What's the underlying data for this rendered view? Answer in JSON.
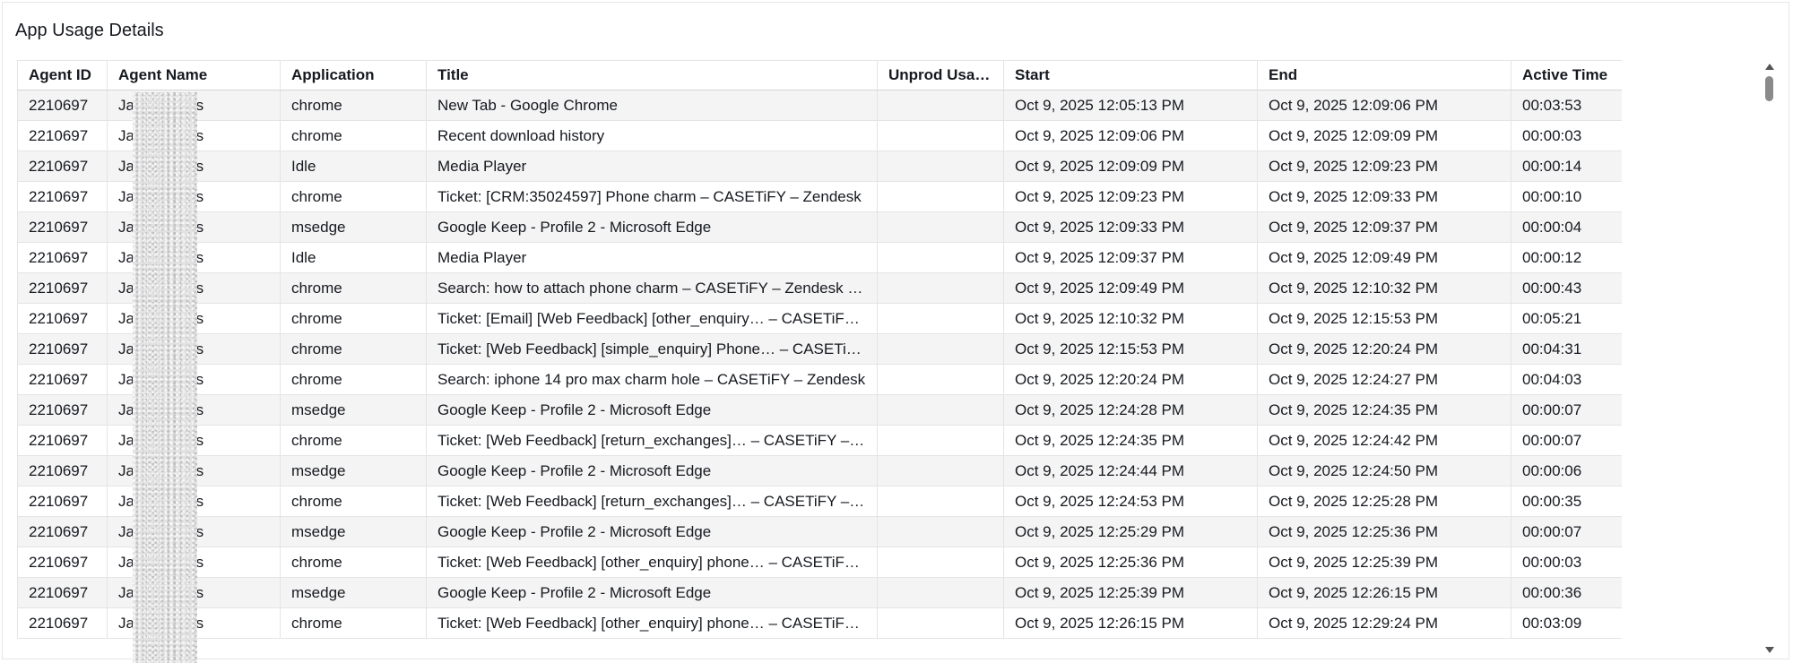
{
  "panel": {
    "title": "App Usage Details"
  },
  "table": {
    "columns": [
      "Agent ID",
      "Agent Name",
      "Application",
      "Title",
      "Unprod Usage",
      "Start",
      "End",
      "Active Time"
    ],
    "rows": [
      [
        "2210697",
        "Jay",
        "res",
        "chrome",
        "New Tab - Google Chrome",
        "",
        "Oct 9, 2025 12:05:13 PM",
        "Oct 9, 2025 12:09:06 PM",
        "00:03:53"
      ],
      [
        "2210697",
        "Jay",
        "res",
        "chrome",
        "Recent download history",
        "",
        "Oct 9, 2025 12:09:06 PM",
        "Oct 9, 2025 12:09:09 PM",
        "00:00:03"
      ],
      [
        "2210697",
        "Jay",
        "res",
        "Idle",
        "Media Player",
        "",
        "Oct 9, 2025 12:09:09 PM",
        "Oct 9, 2025 12:09:23 PM",
        "00:00:14"
      ],
      [
        "2210697",
        "Jay",
        "res",
        "chrome",
        "Ticket: [CRM:35024597] Phone charm – CASETiFY – Zendesk",
        "",
        "Oct 9, 2025 12:09:23 PM",
        "Oct 9, 2025 12:09:33 PM",
        "00:00:10"
      ],
      [
        "2210697",
        "Jay",
        "res",
        "msedge",
        "Google Keep - Profile 2 - Microsoft Edge",
        "",
        "Oct 9, 2025 12:09:33 PM",
        "Oct 9, 2025 12:09:37 PM",
        "00:00:04"
      ],
      [
        "2210697",
        "Jay",
        "res",
        "Idle",
        "Media Player",
        "",
        "Oct 9, 2025 12:09:37 PM",
        "Oct 9, 2025 12:09:49 PM",
        "00:00:12"
      ],
      [
        "2210697",
        "Jay",
        "res",
        "chrome",
        "Search: how to attach phone charm – CASETiFY – Zendesk - Google Chrome",
        "",
        "Oct 9, 2025 12:09:49 PM",
        "Oct 9, 2025 12:10:32 PM",
        "00:00:43"
      ],
      [
        "2210697",
        "Jay",
        "res",
        "chrome",
        "Ticket: [Email] [Web Feedback] [other_enquiry… – CASETiFY – Zendesk",
        "",
        "Oct 9, 2025 12:10:32 PM",
        "Oct 9, 2025 12:15:53 PM",
        "00:05:21"
      ],
      [
        "2210697",
        "Jay",
        "res",
        "chrome",
        "Ticket: [Web Feedback] [simple_enquiry] Phone… – CASETiFY – Zendesk",
        "",
        "Oct 9, 2025 12:15:53 PM",
        "Oct 9, 2025 12:20:24 PM",
        "00:04:31"
      ],
      [
        "2210697",
        "Jay",
        "res",
        "chrome",
        "Search: iphone 14 pro max charm hole – CASETiFY – Zendesk",
        "",
        "Oct 9, 2025 12:20:24 PM",
        "Oct 9, 2025 12:24:27 PM",
        "00:04:03"
      ],
      [
        "2210697",
        "Jay",
        "res",
        "msedge",
        "Google Keep - Profile 2 - Microsoft Edge",
        "",
        "Oct 9, 2025 12:24:28 PM",
        "Oct 9, 2025 12:24:35 PM",
        "00:00:07"
      ],
      [
        "2210697",
        "Jay",
        "res",
        "chrome",
        "Ticket: [Web Feedback] [return_exchanges]… – CASETiFY – Zendesk",
        "",
        "Oct 9, 2025 12:24:35 PM",
        "Oct 9, 2025 12:24:42 PM",
        "00:00:07"
      ],
      [
        "2210697",
        "Jay",
        "res",
        "msedge",
        "Google Keep - Profile 2 - Microsoft Edge",
        "",
        "Oct 9, 2025 12:24:44 PM",
        "Oct 9, 2025 12:24:50 PM",
        "00:00:06"
      ],
      [
        "2210697",
        "Jay",
        "res",
        "chrome",
        "Ticket: [Web Feedback] [return_exchanges]… – CASETiFY – Zendesk",
        "",
        "Oct 9, 2025 12:24:53 PM",
        "Oct 9, 2025 12:25:28 PM",
        "00:00:35"
      ],
      [
        "2210697",
        "Jay",
        "res",
        "msedge",
        "Google Keep - Profile 2 - Microsoft Edge",
        "",
        "Oct 9, 2025 12:25:29 PM",
        "Oct 9, 2025 12:25:36 PM",
        "00:00:07"
      ],
      [
        "2210697",
        "Jay",
        "res",
        "chrome",
        "Ticket: [Web Feedback] [other_enquiry] phone… – CASETiFY – Zendesk",
        "",
        "Oct 9, 2025 12:25:36 PM",
        "Oct 9, 2025 12:25:39 PM",
        "00:00:03"
      ],
      [
        "2210697",
        "Jay",
        "res",
        "msedge",
        "Google Keep - Profile 2 - Microsoft Edge",
        "",
        "Oct 9, 2025 12:25:39 PM",
        "Oct 9, 2025 12:26:15 PM",
        "00:00:36"
      ],
      [
        "2210697",
        "Jay",
        "res",
        "chrome",
        "Ticket: [Web Feedback] [other_enquiry] phone… – CASETiFY – Zendesk",
        "",
        "Oct 9, 2025 12:26:15 PM",
        "Oct 9, 2025 12:29:24 PM",
        "00:03:09"
      ]
    ]
  }
}
